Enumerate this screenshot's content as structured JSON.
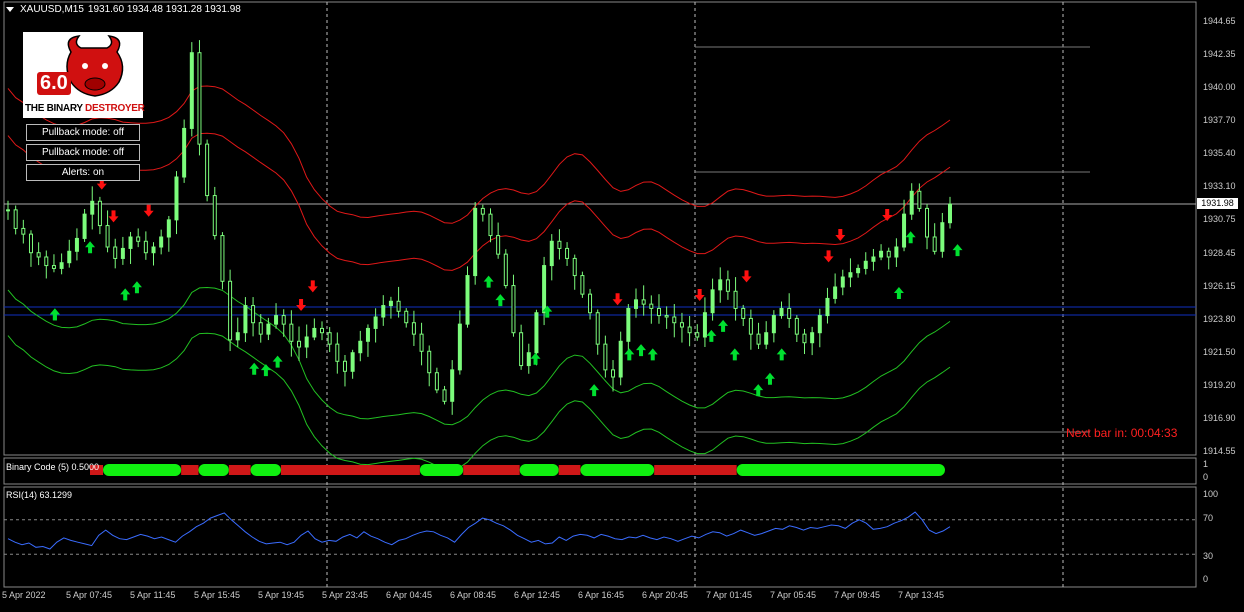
{
  "header": {
    "symbol_timeframe": "XAUUSD,M15",
    "ohlc": "1931.60 1934.48 1931.28 1931.98"
  },
  "logo": {
    "version": "6.0",
    "word1": "THE BINARY",
    "word2": "DESTROYER"
  },
  "buttons": [
    "Pullback mode: off",
    "Pullback mode: off",
    "Alerts: on"
  ],
  "next_bar": "Next bar in: 00:04:33",
  "colors": {
    "background": "#000000",
    "candles": "#7CFC7C",
    "upper_band": "#e01818",
    "lower_band": "#22c022",
    "hline": "#1030c0",
    "rsi": "#3a6cff",
    "buy_arrow": "#00e030",
    "sell_arrow": "#ff1010"
  },
  "chart_data": {
    "type": "candlestick",
    "title": "XAUUSD,M15",
    "current_price": "1931.98",
    "y_tick_labels": [
      "1944.65",
      "1942.35",
      "1940.00",
      "1937.70",
      "1935.40",
      "1933.10",
      "1930.75",
      "1928.45",
      "1926.15",
      "1923.80",
      "1921.50",
      "1919.20",
      "1916.90",
      "1914.55"
    ],
    "ylim": [
      1914.55,
      1944.65
    ],
    "x_tick_labels": [
      "5 Apr 2022",
      "5 Apr 07:45",
      "5 Apr 11:45",
      "5 Apr 15:45",
      "5 Apr 19:45",
      "5 Apr 23:45",
      "6 Apr 04:45",
      "6 Apr 08:45",
      "6 Apr 12:45",
      "6 Apr 16:45",
      "6 Apr 20:45",
      "7 Apr 01:45",
      "7 Apr 05:45",
      "7 Apr 09:45",
      "7 Apr 13:45"
    ],
    "closes": [
      1931.5,
      1930.2,
      1929.8,
      1928.5,
      1928.2,
      1927.6,
      1927.4,
      1927.8,
      1928.6,
      1929.5,
      1931.2,
      1932.1,
      1930.4,
      1928.9,
      1928.1,
      1928.8,
      1929.6,
      1929.3,
      1928.5,
      1928.9,
      1929.6,
      1930.8,
      1933.8,
      1937.2,
      1942.5,
      1936.1,
      1932.5,
      1929.7,
      1926.5,
      1922.4,
      1922.9,
      1924.8,
      1923.6,
      1922.8,
      1923.5,
      1924.1,
      1923.5,
      1922.3,
      1921.9,
      1922.6,
      1923.2,
      1922.9,
      1922.1,
      1920.9,
      1920.2,
      1921.5,
      1922.3,
      1923.2,
      1924.0,
      1924.8,
      1925.1,
      1924.4,
      1923.6,
      1922.8,
      1921.6,
      1920.1,
      1918.9,
      1918.1,
      1920.3,
      1923.5,
      1926.9,
      1931.6,
      1931.2,
      1929.7,
      1928.4,
      1926.2,
      1922.9,
      1920.6,
      1921.5,
      1924.3,
      1927.6,
      1929.3,
      1928.8,
      1928.1,
      1926.9,
      1925.6,
      1924.3,
      1922.1,
      1920.3,
      1919.8,
      1922.3,
      1924.6,
      1925.2,
      1924.9,
      1924.6,
      1924.1,
      1924.0,
      1923.6,
      1923.3,
      1922.9,
      1922.6,
      1924.3,
      1925.9,
      1926.6,
      1925.8,
      1924.6,
      1923.9,
      1922.8,
      1922.1,
      1922.9,
      1924.1,
      1924.6,
      1923.9,
      1922.8,
      1922.2,
      1922.9,
      1924.1,
      1925.3,
      1926.1,
      1926.8,
      1927.1,
      1927.4,
      1927.9,
      1928.2,
      1928.6,
      1928.2,
      1928.9,
      1931.2,
      1932.8,
      1931.6,
      1929.6,
      1928.6,
      1930.6,
      1931.9
    ],
    "indicators": {
      "binary_code_label": "Binary Code (5) 0.5000",
      "binary_code_ticks": [
        "1",
        "0"
      ],
      "rsi_label": "RSI(14) 63.1299",
      "rsi_ticks": [
        "100",
        "70",
        "30",
        "0"
      ],
      "rsi_levels": [
        70,
        30
      ],
      "rsi_values": [
        48,
        44,
        41,
        43,
        38,
        39,
        36,
        44,
        49,
        46,
        44,
        42,
        40,
        52,
        58,
        52,
        48,
        47,
        50,
        53,
        51,
        48,
        50,
        47,
        44,
        51,
        56,
        62,
        66,
        72,
        75,
        78,
        70,
        63,
        56,
        50,
        45,
        42,
        43,
        44,
        41,
        44,
        52,
        57,
        48,
        44,
        46,
        45,
        50,
        53,
        49,
        56,
        51,
        48,
        44,
        41,
        46,
        48,
        52,
        55,
        57,
        56,
        52,
        49,
        44,
        53,
        61,
        66,
        72,
        70,
        66,
        63,
        58,
        52,
        48,
        44,
        46,
        42,
        43,
        50,
        46,
        51,
        53,
        52,
        49,
        53,
        51,
        48,
        47,
        50,
        49,
        52,
        49,
        47,
        50,
        48,
        45,
        48,
        51,
        49,
        53,
        56,
        55,
        51,
        54,
        58,
        55,
        52,
        54,
        57,
        60,
        59,
        63,
        61,
        58,
        61,
        60,
        62,
        64,
        63,
        60,
        66,
        70,
        66,
        59,
        60,
        62,
        66,
        69,
        73,
        79,
        70,
        58,
        54,
        57,
        62
      ],
      "binary_code_segments": [
        [
          "red",
          0.0,
          0.015
        ],
        [
          "green",
          0.015,
          0.105
        ],
        [
          "red",
          0.105,
          0.125
        ],
        [
          "green",
          0.125,
          0.16
        ],
        [
          "red",
          0.16,
          0.185
        ],
        [
          "green",
          0.185,
          0.22
        ],
        [
          "red",
          0.22,
          0.38
        ],
        [
          "green",
          0.38,
          0.43
        ],
        [
          "red",
          0.43,
          0.495
        ],
        [
          "green",
          0.495,
          0.54
        ],
        [
          "red",
          0.54,
          0.565
        ],
        [
          "green",
          0.565,
          0.65
        ],
        [
          "red",
          0.65,
          0.745
        ],
        [
          "green",
          0.745,
          0.985
        ]
      ]
    },
    "signals": {
      "buy": [
        4,
        4,
        7,
        10,
        11,
        21,
        22,
        23,
        41,
        42,
        45,
        46,
        50,
        53,
        54,
        55,
        60,
        61,
        62,
        64,
        65,
        66,
        76,
        77,
        81
      ],
      "sell": [
        8,
        9,
        12,
        25,
        26,
        52,
        59,
        63,
        70,
        71,
        75
      ]
    }
  }
}
